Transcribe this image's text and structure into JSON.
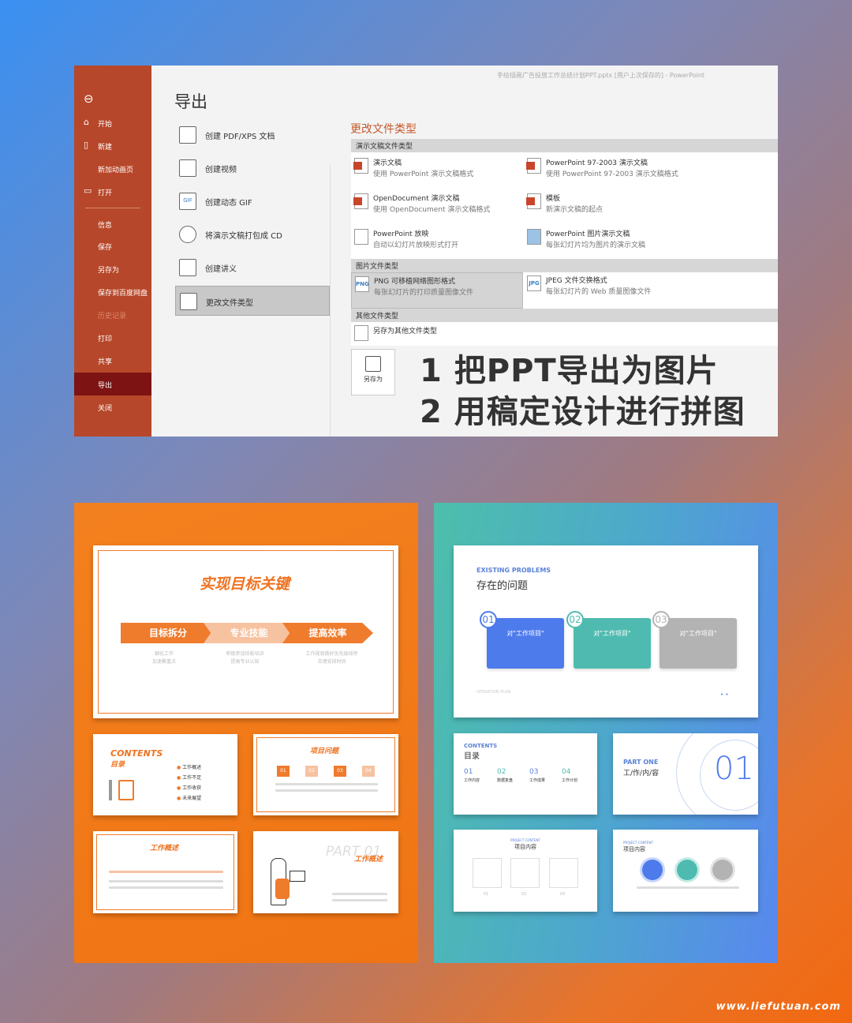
{
  "window": {
    "file_title": "手绘插画广告投放工作总结计划PPT.pptx [用户上次保存的]  -  PowerPoint"
  },
  "sidebar": {
    "back_icon": "back-arrow-icon",
    "items": [
      {
        "label": "开始",
        "icon": "home-icon"
      },
      {
        "label": "新建",
        "icon": "new-file-icon"
      },
      {
        "label": "新加动画页"
      },
      {
        "label": "打开",
        "icon": "folder-icon"
      },
      {
        "label": "信息"
      },
      {
        "label": "保存"
      },
      {
        "label": "另存为"
      },
      {
        "label": "保存到百度网盘"
      },
      {
        "label": "历史记录",
        "disabled": true
      },
      {
        "label": "打印"
      },
      {
        "label": "共享"
      },
      {
        "label": "导出",
        "selected": true
      },
      {
        "label": "关闭"
      }
    ]
  },
  "export": {
    "title": "导出",
    "items": [
      {
        "label": "创建 PDF/XPS 文档",
        "icon": "pdf-icon"
      },
      {
        "label": "创建视频",
        "icon": "video-icon"
      },
      {
        "label": "创建动态 GIF",
        "icon": "gif-icon",
        "glyph": "GIF"
      },
      {
        "label": "将演示文稿打包成 CD",
        "icon": "cd-icon"
      },
      {
        "label": "创建讲义",
        "icon": "handout-icon"
      },
      {
        "label": "更改文件类型",
        "icon": "change-type-icon",
        "selected": true
      }
    ]
  },
  "change_type": {
    "title": "更改文件类型",
    "sections": [
      {
        "header": "演示文稿文件类型",
        "items": [
          {
            "name": "演示文稿",
            "desc": "使用 PowerPoint 演示文稿格式"
          },
          {
            "name": "PowerPoint 97-2003 演示文稿",
            "desc": "使用 PowerPoint 97-2003 演示文稿格式"
          },
          {
            "name": "OpenDocument 演示文稿",
            "desc": "使用 OpenDocument 演示文稿格式"
          },
          {
            "name": "模板",
            "desc": "新演示文稿的起点"
          },
          {
            "name": "PowerPoint 放映",
            "desc": "自动以幻灯片放映形式打开"
          },
          {
            "name": "PowerPoint 图片演示文稿",
            "desc": "每张幻灯片均为图片的演示文稿"
          }
        ]
      },
      {
        "header": "图片文件类型",
        "items": [
          {
            "name": "PNG 可移植网络图形格式",
            "desc": "每张幻灯片的打印质量图像文件",
            "glyph": "PNG",
            "selected": true
          },
          {
            "name": "JPEG 文件交换格式",
            "desc": "每张幻灯片的 Web 质量图像文件",
            "glyph": "JPG"
          }
        ]
      },
      {
        "header": "其他文件类型",
        "items": [
          {
            "name": "另存为其他文件类型"
          }
        ]
      }
    ],
    "save_as_label": "另存为"
  },
  "overlay": {
    "line1": "1 把PPT导出为图片",
    "line2": "2 用稿定设计进行拼图"
  },
  "orange_slides": {
    "s1": {
      "title": "实现目标关键",
      "steps": [
        "目标拆分",
        "专业技能",
        "提高效率"
      ],
      "subs": [
        "细化工作\n加速聚重点",
        "积极参加技能培训\n提高专业认知",
        "工作规划做好优先级排序\n合理安排时间"
      ]
    },
    "s2": {
      "title": "CONTENTS",
      "subtitle": "目录",
      "items": [
        "工作概述",
        "工作不足",
        "工作收获",
        "未来展望"
      ]
    },
    "s3": {
      "title": "项目问题",
      "nums": [
        "01",
        "02",
        "03",
        "04"
      ]
    },
    "s4": {
      "title": "工作概述"
    },
    "s5": {
      "part": "PART 01",
      "title": "工作概述"
    }
  },
  "blue_slides": {
    "s1": {
      "eyebrow": "EXISTING PROBLEMS",
      "title": "存在的问题",
      "cards": [
        {
          "num": "01",
          "text": "对\"工作项目\"",
          "color": "#4e7bec"
        },
        {
          "num": "02",
          "text": "对\"工作项目\"",
          "color": "#4fbbb0"
        },
        {
          "num": "03",
          "text": "对\"工作项目\"",
          "color": "#b3b3b3"
        }
      ],
      "footer": "OPERATION PLAN"
    },
    "s2": {
      "eyebrow": "CONTENTS",
      "title": "目录",
      "items": [
        {
          "num": "01",
          "label": "工作内容"
        },
        {
          "num": "02",
          "label": "数据复盘"
        },
        {
          "num": "03",
          "label": "工作成果"
        },
        {
          "num": "04",
          "label": "工作计划"
        }
      ]
    },
    "s3": {
      "eyebrow": "PART ONE",
      "title": "工/作/内/容",
      "big": "01"
    },
    "s4": {
      "eyebrow": "PROJECT CONTENT",
      "title": "项目内容",
      "nums": [
        "01",
        "02",
        "03"
      ]
    },
    "s5": {
      "eyebrow": "PROJECT CONTENT",
      "title": "项目内容"
    }
  },
  "watermark": "www.liefutuan.com",
  "colors": {
    "ppt_sidebar": "#b7472a",
    "ppt_selected": "#7d1313",
    "accent_orange": "#ee7322",
    "accent_blue": "#4e7bec"
  }
}
